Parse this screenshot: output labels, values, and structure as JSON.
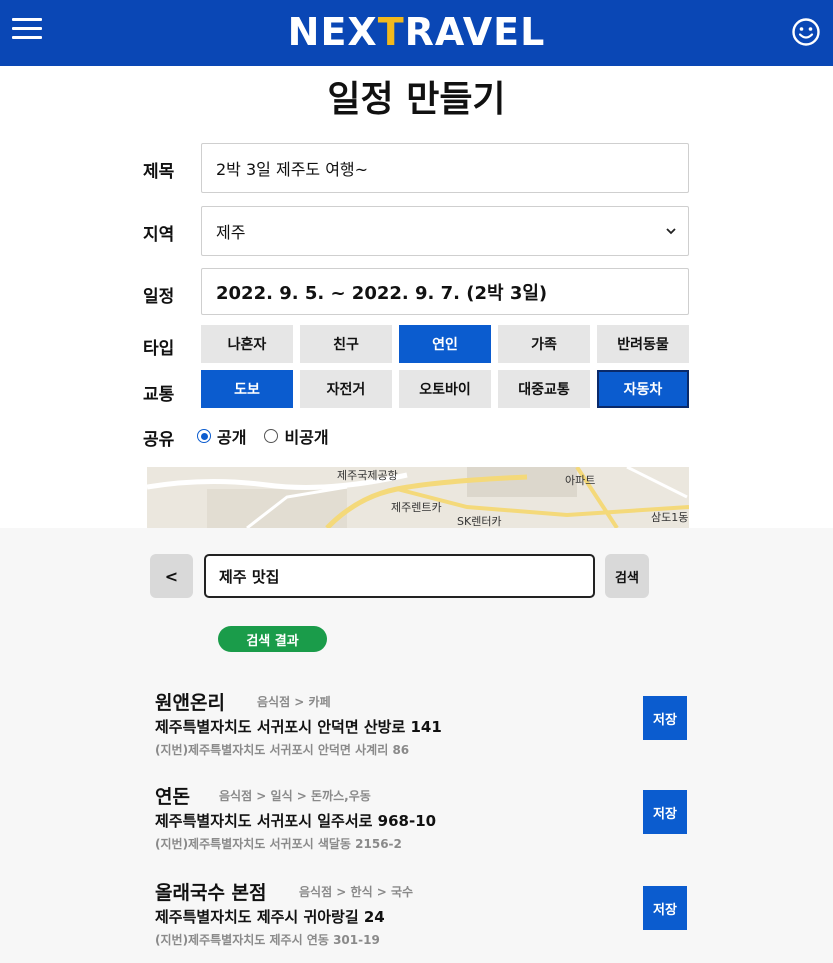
{
  "header": {
    "logo_main": "NEX",
    "logo_accent": "T",
    "logo_rest": "RAVEL",
    "menu_icon": "hamburger-menu-icon",
    "user_icon": "smiley-face-icon",
    "bg_color": "#0a47b5",
    "accent_color": "#f2b91d"
  },
  "page": {
    "title": "일정 만들기"
  },
  "form": {
    "title_label": "제목",
    "title_value": "2박 3일 제주도 여행~",
    "region_label": "지역",
    "region_value": "제주",
    "schedule_label": "일정",
    "schedule_value": "2022. 9. 5. ~ 2022. 9. 7. (2박 3일)",
    "type_label": "타입",
    "type_options": [
      "나혼자",
      "친구",
      "연인",
      "가족",
      "반려동물"
    ],
    "type_selected": "연인",
    "transport_label": "교통",
    "transport_options": [
      "도보",
      "자전거",
      "오토바이",
      "대중교통",
      "자동차"
    ],
    "transport_selected": [
      "도보",
      "자동차"
    ],
    "share_label": "공유",
    "share_options": [
      "공개",
      "비공개"
    ],
    "share_selected": "공개"
  },
  "map": {
    "labels": [
      "제주국제공항",
      "제주렌트카",
      "SK렌터카",
      "아파트",
      "삼도1동"
    ]
  },
  "search": {
    "back_label": "<",
    "query": "제주 맛집",
    "button_label": "검색",
    "results_badge": "검색 결과",
    "results": [
      {
        "name": "원앤온리",
        "category": "음식점 > 카페",
        "address": "제주특별자치도 서귀포시 안덕면 산방로 141",
        "jibun": "(지번)제주특별자치도 서귀포시 안덕면 사계리 86",
        "save_label": "저장"
      },
      {
        "name": "연돈",
        "category": "음식점 > 일식 > 돈까스,우동",
        "address": "제주특별자치도 서귀포시 일주서로 968-10",
        "jibun": "(지번)제주특별자치도 서귀포시 색달동 2156-2",
        "save_label": "저장"
      },
      {
        "name": "올래국수 본점",
        "category": "음식점 > 한식 > 국수",
        "address": "제주특별자치도 제주시 귀아랑길 24",
        "jibun": "(지번)제주특별자치도 제주시 연동 301-19",
        "save_label": "저장"
      }
    ]
  }
}
